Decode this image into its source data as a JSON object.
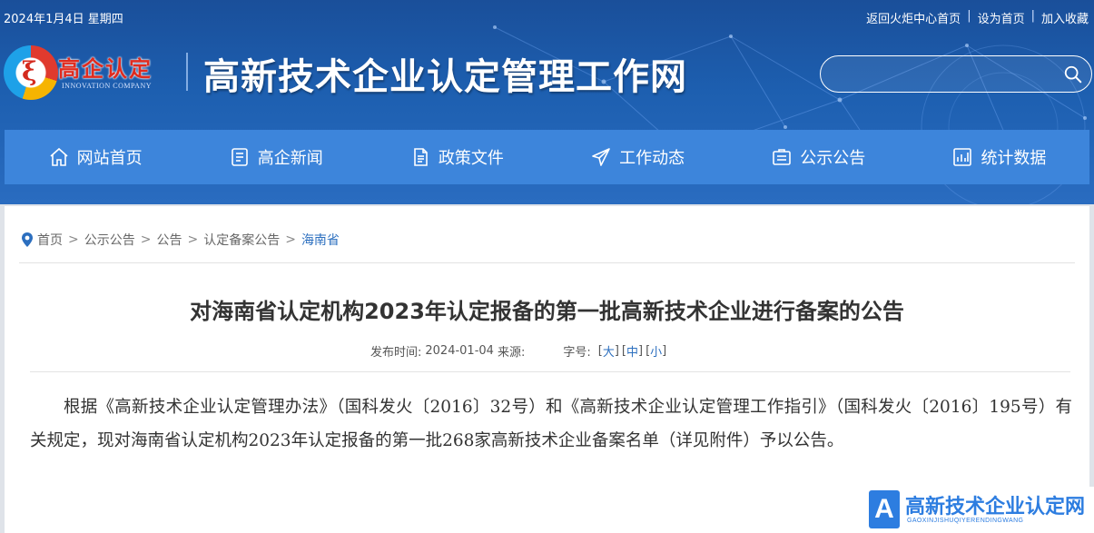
{
  "topbar": {
    "date": "2024年1月4日 星期四",
    "links": [
      "返回火炬中心首页",
      "设为首页",
      "加入收藏"
    ],
    "separator": "|"
  },
  "logo": {
    "text": "高企认定",
    "sub": "INNOVATION COMPANY"
  },
  "site": {
    "title": "高新技术企业认定管理工作网"
  },
  "search": {
    "value": "",
    "placeholder": "",
    "icon": "search-icon"
  },
  "nav": {
    "items": [
      {
        "label": "网站首页",
        "icon": "home-icon"
      },
      {
        "label": "高企新闻",
        "icon": "news-icon"
      },
      {
        "label": "政策文件",
        "icon": "document-icon"
      },
      {
        "label": "工作动态",
        "icon": "send-icon"
      },
      {
        "label": "公示公告",
        "icon": "notice-icon"
      },
      {
        "label": "统计数据",
        "icon": "chart-icon"
      }
    ]
  },
  "breadcrumb": {
    "icon": "location-pin-icon",
    "items": [
      "首页",
      "公示公告",
      "公告",
      "认定备案公告",
      "海南省"
    ],
    "separator": ">"
  },
  "article": {
    "title": "对海南省认定机构2023年认定报备的第一批高新技术企业进行备案的公告",
    "meta": {
      "published_label": "发布时间:",
      "published": "2024-01-04",
      "source_label": "来源:",
      "fontsize_label": "字号:",
      "sizes": [
        "大",
        "中",
        "小"
      ]
    },
    "body": "根据《高新技术企业认定管理办法》（国科发火〔2016〕32号）和《高新技术企业认定管理工作指引》（国科发火〔2016〕195号）有关规定，现对海南省认定机构2023年认定报备的第一批268家高新技术企业备案名单（详见附件）予以公告。"
  },
  "watermark": {
    "letter": "A",
    "title": "高新技术企业认定网",
    "sub": "GAOXINJISHUQIYERENDINGWANG"
  },
  "colors": {
    "header_bg": "#1d5fb0",
    "nav_bg": "#3d85db",
    "link_blue": "#2c6fbf",
    "logo_red": "#e02b1f"
  }
}
